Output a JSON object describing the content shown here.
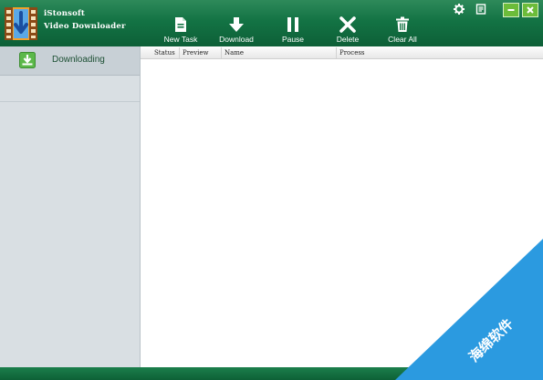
{
  "app": {
    "name_line1": "iStonsoft",
    "name_line2": "Video Downloader"
  },
  "toolbar": {
    "new_task": "New Task",
    "download": "Download",
    "pause": "Pause",
    "delete": "Delete",
    "clear_all": "Clear All"
  },
  "sidebar": {
    "items": [
      {
        "label": "Downloading",
        "icon": "download-icon"
      }
    ]
  },
  "table": {
    "columns": [
      "Status",
      "Preview",
      "Name",
      "Process"
    ],
    "rows": []
  },
  "watermark": {
    "text": "海绵软件"
  },
  "colors": {
    "titlebar": "#137344",
    "sidebar": "#d9dfe3",
    "watermark": "#2b9ae0"
  }
}
